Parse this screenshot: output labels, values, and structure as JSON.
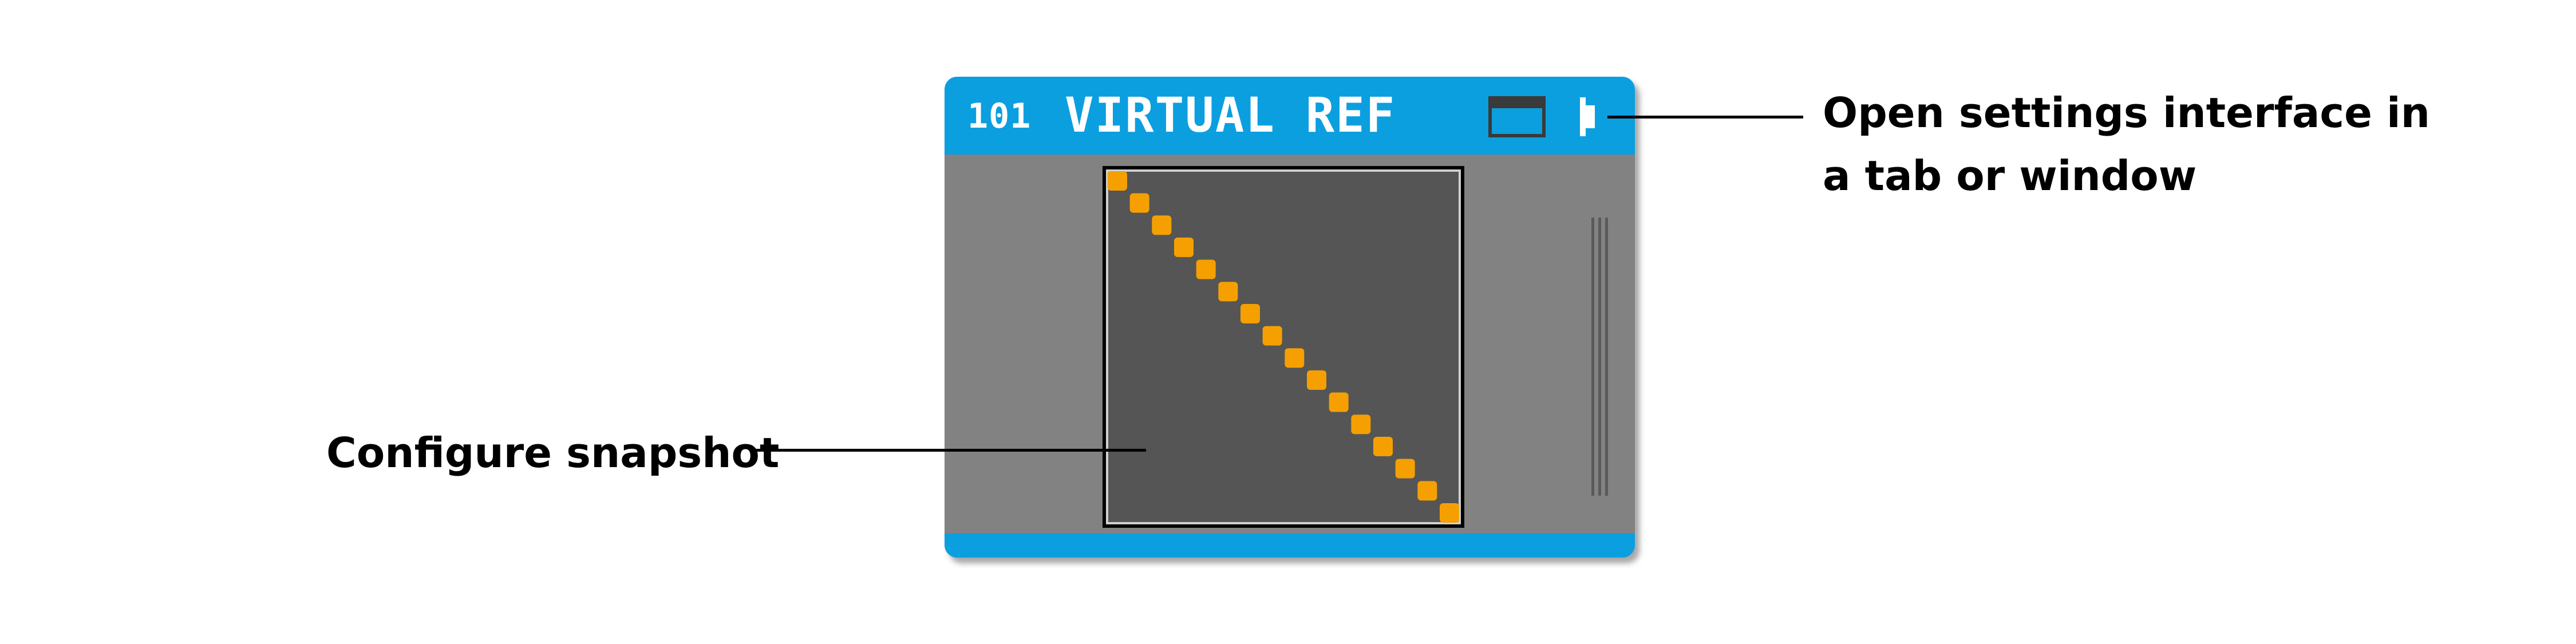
{
  "module": {
    "number": "101",
    "title": "VIRTUAL REF",
    "colors": {
      "header": "#0b9fe0",
      "body": "#828282",
      "snapshot_bg": "#555555",
      "snapshot_dots": "#f5a000"
    },
    "icons": {
      "window": "window-icon",
      "settings": "pin-icon"
    },
    "snapshot": {
      "dot_count": 16,
      "pattern": "diagonal"
    }
  },
  "callouts": {
    "settings": {
      "line1": "Open settings interface in",
      "line2": "a tab or window"
    },
    "snapshot": {
      "text": "Configure snapshot"
    }
  }
}
